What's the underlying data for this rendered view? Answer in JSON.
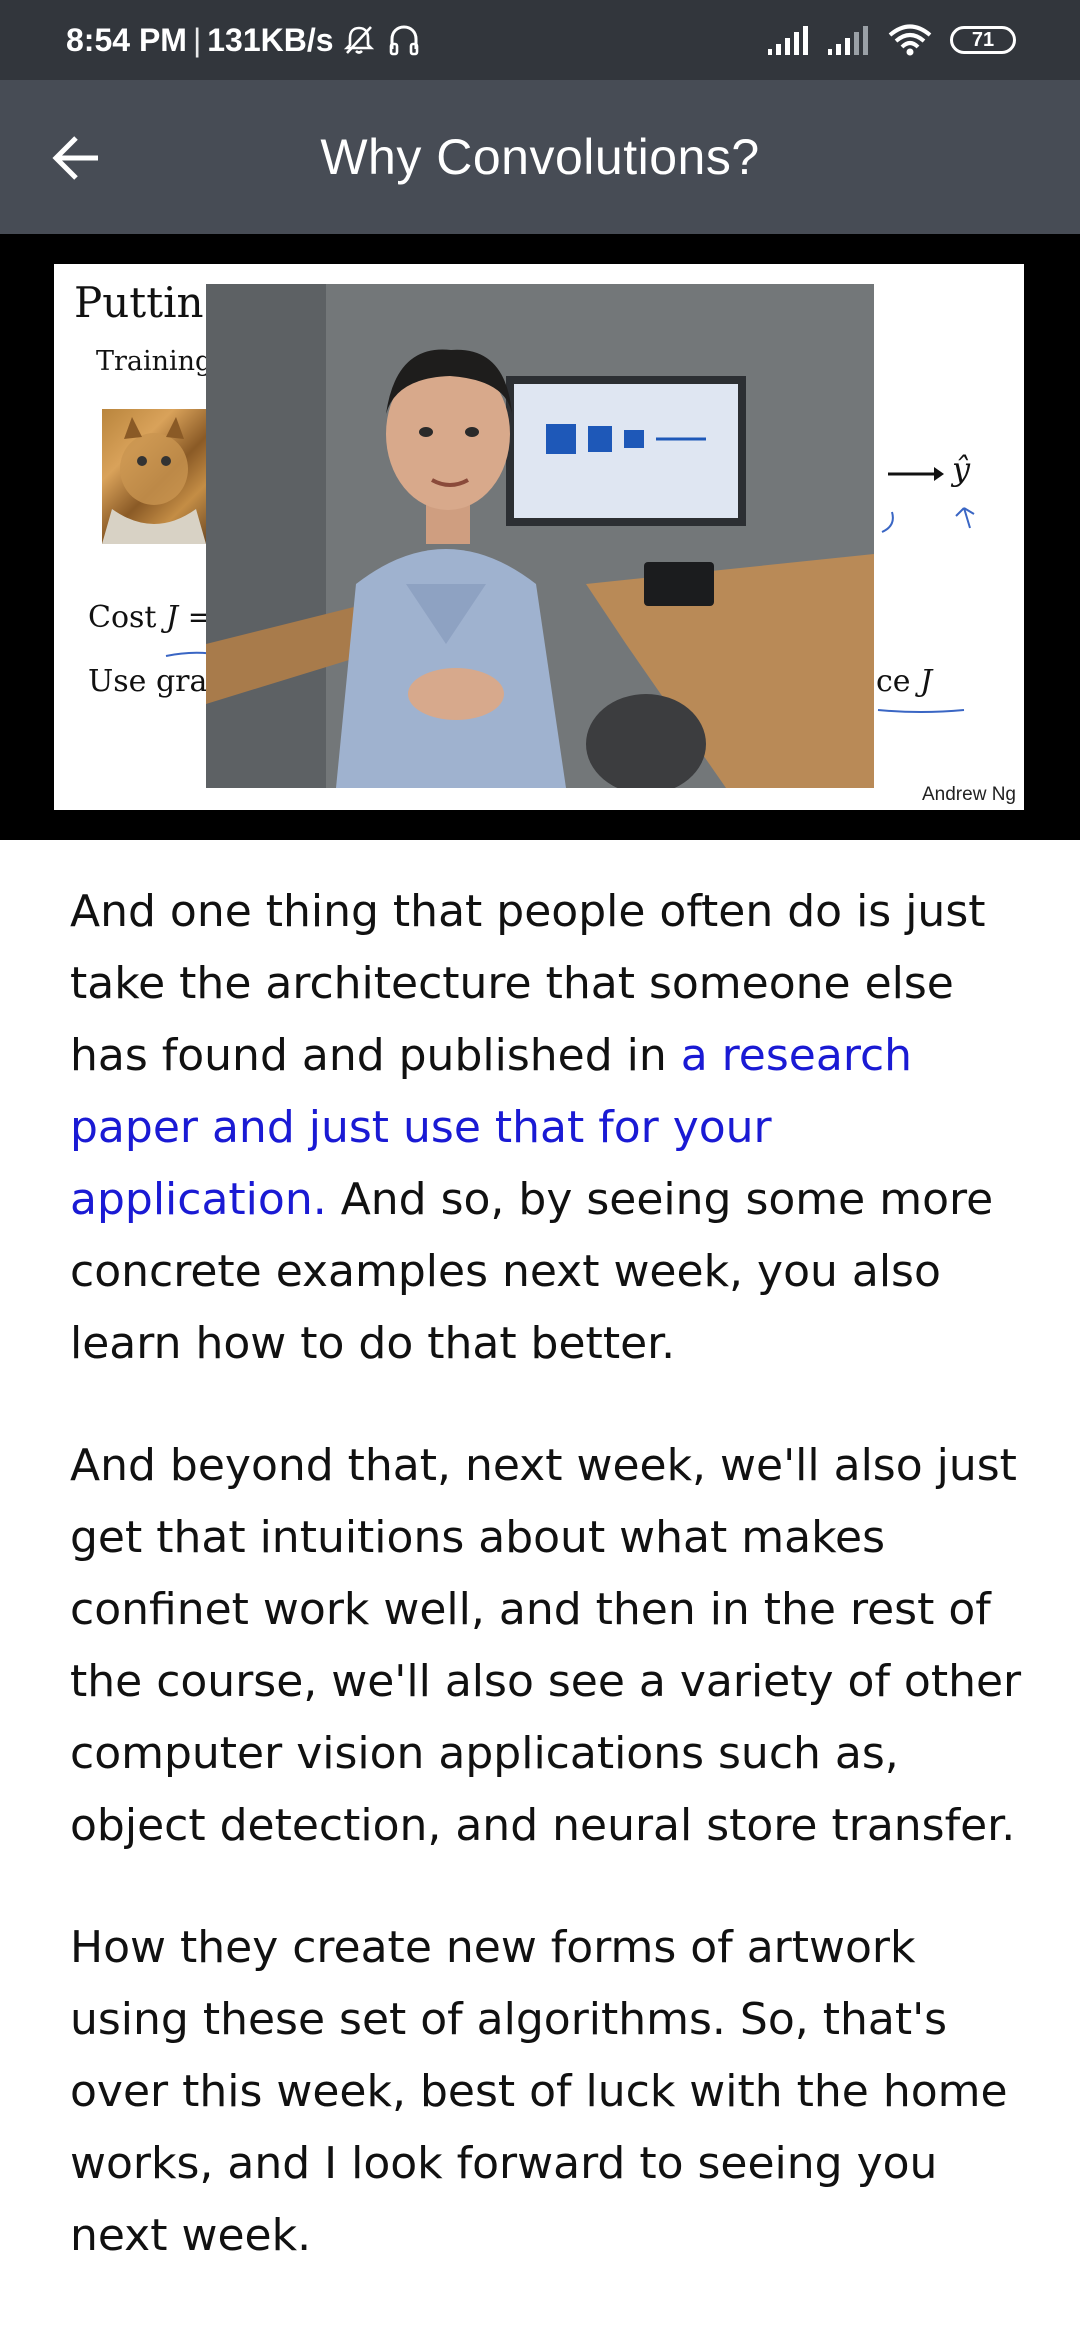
{
  "status_bar": {
    "time": "8:54 PM",
    "separator": "|",
    "speed": "131KB/s",
    "battery_level": "71",
    "icons": [
      "alarm-off-icon",
      "headphones-icon",
      "signal-icon",
      "signal-icon",
      "wifi-icon",
      "battery-icon"
    ]
  },
  "app_bar": {
    "back_icon": "arrow-left-icon",
    "title": "Why Convolutions?"
  },
  "video": {
    "slide_title": "Puttin",
    "slide_training": "Training",
    "slide_cost": "Cost",
    "slide_cost_j": "J =",
    "slide_use": "Use gra",
    "slide_ce": "ce",
    "slide_j": "J",
    "slide_yhat": "ŷ",
    "slide_author": "Andrew Ng"
  },
  "transcript": {
    "p1_before": "And one thing that people often do is just take the architecture that someone else has found and published in ",
    "p1_highlight": "a research paper and just use that for your application.",
    "p1_after": " And so, by seeing some more concrete examples next week, you also learn how to do that better.",
    "p2": "And beyond that, next week, we'll also just get that intuitions about what makes confinet work well, and then in the rest of the course, we'll also see a variety of other computer vision applications such as, object detection, and neural store transfer.",
    "p3": "How they create new forms of artwork using these set of algorithms. So, that's over this week, best of luck with the home works, and I look forward to seeing you next week."
  },
  "colors": {
    "status_bar_bg": "#32363c",
    "app_bar_bg": "#474c55",
    "highlight_text": "#1a1ad4"
  }
}
